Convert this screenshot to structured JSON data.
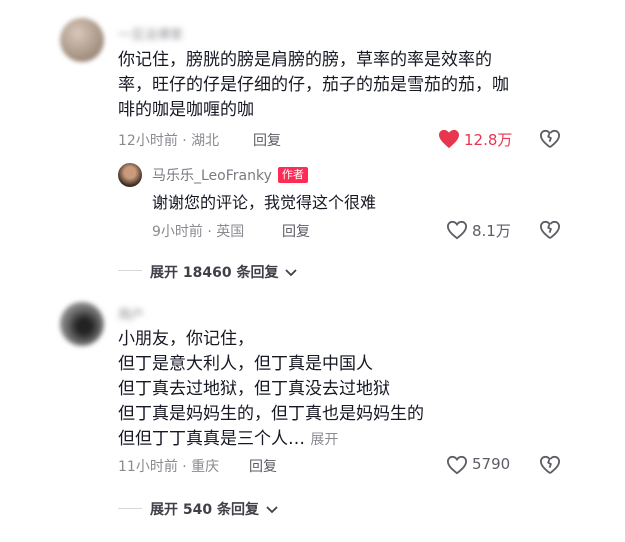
{
  "comments": [
    {
      "username": "一见法律家",
      "text_lines": [
        "你记住，膀胱的膀是肩膀的膀，草率的率是效率的",
        "率，旺仔的仔是仔细的仔，茄子的茄是雪茄的茄，咖",
        "啡的咖是咖喱的咖"
      ],
      "time_location": "12小时前 · 湖北",
      "reply_label": "回复",
      "likes": "12.8万",
      "reply": {
        "username": "马乐乐_LeoFranky",
        "badge": "作者",
        "text": "谢谢您的评论，我觉得这个很难",
        "time_location": "9小时前 · 英国",
        "reply_label": "回复",
        "likes": "8.1万"
      },
      "expand_label": "展开 18460 条回复"
    },
    {
      "username": "用户",
      "text_lines": [
        "小朋友，你记住，",
        "但丁是意大利人，但丁真是中国人",
        "但丁真去过地狱，但丁真没去过地狱",
        "但丁真是妈妈生的，但丁真也是妈妈生的",
        "但但丁丁真真是三个人…"
      ],
      "more_label": "展开",
      "time_location": "11小时前 · 重庆",
      "reply_label": "回复",
      "likes": "5790",
      "expand_label": "展开 540 条回复"
    }
  ],
  "colors": {
    "liked": "#e8364f",
    "badge": "#fe2c55",
    "meta": "#8a8b91"
  },
  "icons": [
    "heart-filled-icon",
    "heart-outline-icon",
    "dislike-heart-icon",
    "chevron-down-icon"
  ]
}
